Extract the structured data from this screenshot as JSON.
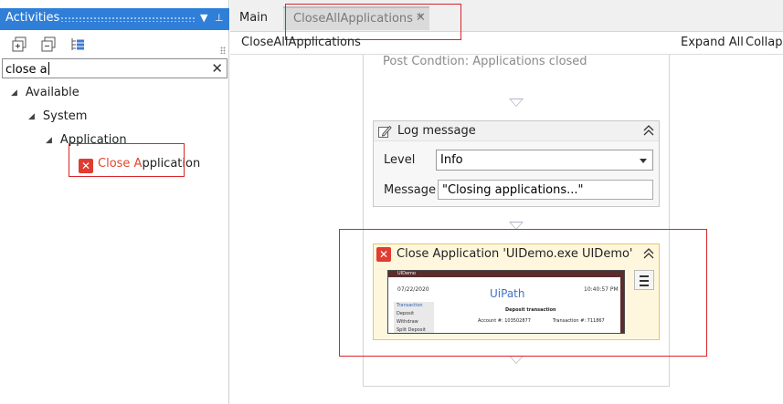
{
  "activities_panel": {
    "title": "Activities",
    "search": {
      "value": "close a"
    },
    "tree": {
      "available": "Available",
      "system": "System",
      "application": "Application",
      "close_application": {
        "prefix": "Close A",
        "rest": "pplication"
      }
    }
  },
  "tabs": [
    {
      "label": "Main"
    },
    {
      "label": "CloseAllApplications *"
    }
  ],
  "designer": {
    "breadcrumb": "CloseAllApplications",
    "expand_all": "Expand All",
    "collapse_all": "Collaps",
    "post_condition": "Post Condtion: Applications closed",
    "log_message": {
      "title": "Log message",
      "level_label": "Level",
      "level_value": "Info",
      "message_label": "Message",
      "message_value": "\"Closing applications...\""
    },
    "close_application": {
      "title": "Close Application 'UIDemo.exe  UIDemo'",
      "thumbnail": {
        "title": "UIDemo",
        "date": "07/22/2020",
        "time": "10:40:57 PM",
        "brand": "UiPath",
        "sidebar_header": "Transaction",
        "sidebar_items": [
          "Deposit",
          "Withdraw",
          "Split Deposit"
        ],
        "heading": "Deposit transaction",
        "account": "Account #: 103502877",
        "transaction": "Transaction #: 711867"
      }
    }
  },
  "colors": {
    "panel_header": "#2f7fd9",
    "error_red": "#e03c31",
    "highlight_red": "#d8262b",
    "activity_yellow": "#fff7dd"
  },
  "icons": {
    "header_dropdown": "dropdown-arrow-icon",
    "header_pin": "pin-icon",
    "toolbar": [
      "expand-all-icon",
      "collapse-all-icon",
      "show-tree-icon"
    ],
    "search_clear": "clear-icon",
    "close_app": "error-cross-icon",
    "log": "pen-icon",
    "collapse": "chevron-up-double-icon",
    "menu": "hamburger-menu-icon"
  }
}
